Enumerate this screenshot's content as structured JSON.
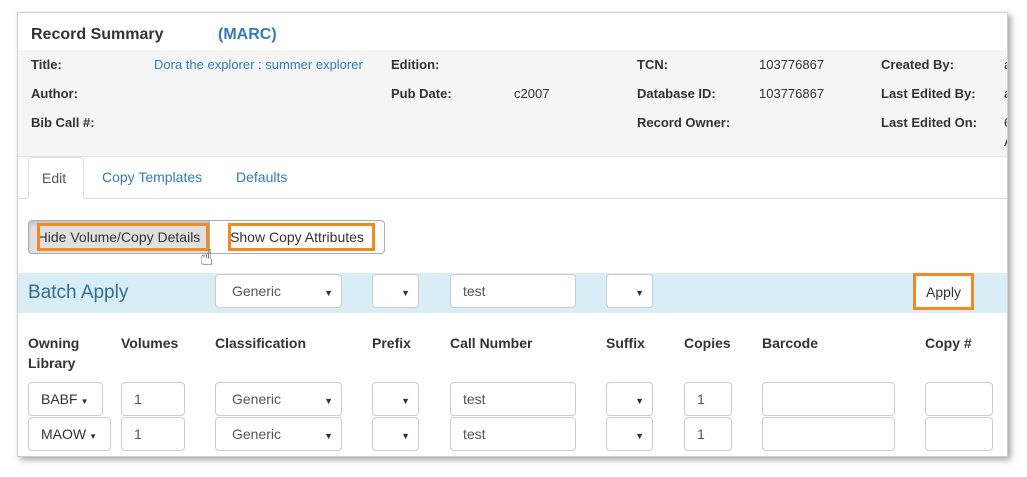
{
  "header": {
    "title": "Record Summary",
    "marc_link": "(MARC)"
  },
  "summary": {
    "title_label": "Title:",
    "title_value": "Dora the explorer : summer explorer",
    "edition_label": "Edition:",
    "tcn_label": "TCN:",
    "tcn_value": "103776867",
    "created_by_label": "Created By:",
    "created_by_value": "a",
    "author_label": "Author:",
    "pub_date_label": "Pub Date:",
    "pub_date_value": "c2007",
    "database_id_label": "Database ID:",
    "database_id_value": "103776867",
    "last_edited_by_label": "Last Edited By:",
    "last_edited_by_value": "a",
    "bib_call_label": "Bib Call #:",
    "record_owner_label": "Record Owner:",
    "last_edited_on_label": "Last Edited On:",
    "last_edited_on_value_1": "6",
    "last_edited_on_value_2": "A"
  },
  "tabs": [
    {
      "label": "Edit"
    },
    {
      "label": "Copy Templates"
    },
    {
      "label": "Defaults"
    }
  ],
  "toolbar": {
    "hide_details_label": "Hide Volume/Copy Details",
    "show_attributes_label": "Show Copy Attributes"
  },
  "batch": {
    "title": "Batch Apply",
    "classification": "Generic",
    "prefix": "",
    "call_number": "test",
    "suffix": "",
    "apply_label": "Apply"
  },
  "columns": {
    "owning_library_1": "Owning",
    "owning_library_2": "Library",
    "volumes": "Volumes",
    "classification": "Classification",
    "prefix": "Prefix",
    "call_number": "Call Number",
    "suffix": "Suffix",
    "copies": "Copies",
    "barcode": "Barcode",
    "copy_num": "Copy #"
  },
  "rows": [
    {
      "library": "BABF",
      "volumes": "1",
      "classification": "Generic",
      "call_number": "test",
      "copies": "1",
      "barcode": "",
      "copy_num": ""
    },
    {
      "library": "MAOW",
      "volumes": "1",
      "classification": "Generic",
      "call_number": "test",
      "copies": "1",
      "barcode": "",
      "copy_num": ""
    }
  ],
  "colors": {
    "link": "#337ab7",
    "highlight": "#f08a24",
    "batch_bg": "#d9edf7"
  }
}
